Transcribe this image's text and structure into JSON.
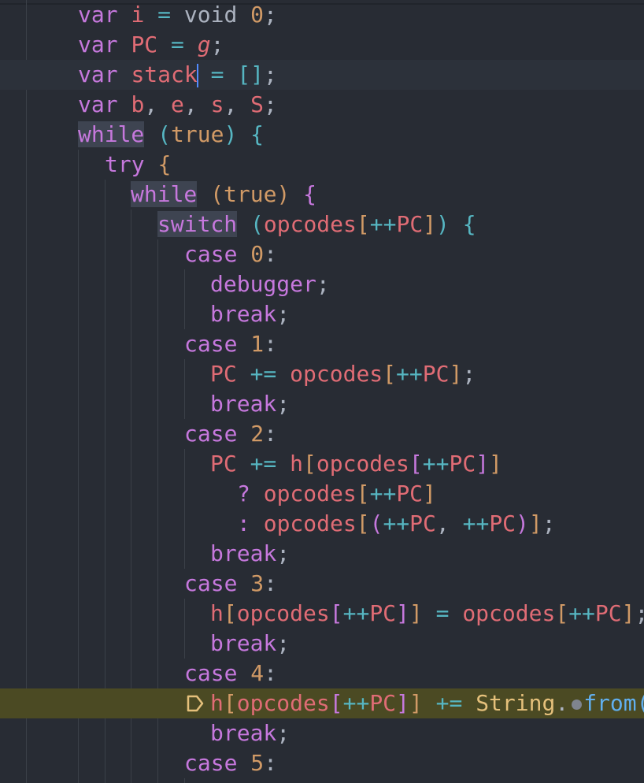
{
  "editor": {
    "lines": [
      [
        "var",
        " ",
        "i",
        " ",
        "=",
        " ",
        "void",
        " ",
        "0",
        ";"
      ],
      [
        "var",
        " ",
        "PC",
        " ",
        "=",
        " ",
        "g",
        ";"
      ],
      [
        "var",
        " ",
        "stack",
        " ",
        "=",
        " ",
        "[",
        "]",
        ";"
      ],
      [
        "var",
        " ",
        "b",
        ", ",
        "e",
        ", ",
        "s",
        ", ",
        "S",
        ";"
      ],
      [
        "while",
        " ",
        "(",
        "true",
        ")",
        " ",
        "{"
      ],
      [
        "try",
        " ",
        "{"
      ],
      [
        "while",
        " ",
        "(",
        "true",
        ")",
        " ",
        "{"
      ],
      [
        "switch",
        " ",
        "(",
        "opcodes",
        "[",
        "++",
        "PC",
        "]",
        ")",
        " ",
        "{"
      ],
      [
        "case",
        " ",
        "0",
        ":"
      ],
      [
        "debugger",
        ";"
      ],
      [
        "break",
        ";"
      ],
      [
        "case",
        " ",
        "1",
        ":"
      ],
      [
        "PC",
        " ",
        "+=",
        " ",
        "opcodes",
        "[",
        "++",
        "PC",
        "]",
        ";"
      ],
      [
        "break",
        ";"
      ],
      [
        "case",
        " ",
        "2",
        ":"
      ],
      [
        "PC",
        " ",
        "+=",
        " ",
        "h",
        "[",
        "opcodes",
        "[",
        "++",
        "PC",
        "]",
        "]"
      ],
      [
        "?",
        " ",
        "opcodes",
        "[",
        "++",
        "PC",
        "]"
      ],
      [
        ":",
        " ",
        "opcodes",
        "[",
        "(",
        "++",
        "PC",
        ", ",
        "++",
        "PC",
        ")",
        "]",
        ";"
      ],
      [
        "break",
        ";"
      ],
      [
        "case",
        " ",
        "3",
        ":"
      ],
      [
        "h",
        "[",
        "opcodes",
        "[",
        "++",
        "PC",
        "]",
        "]",
        " ",
        "=",
        " ",
        "opcodes",
        "[",
        "++",
        "PC",
        "]",
        ";"
      ],
      [
        "break",
        ";"
      ],
      [
        "case",
        " ",
        "4",
        ":"
      ],
      [
        "h",
        "[",
        "opcodes",
        "[",
        "++",
        "PC",
        "]",
        "]",
        " ",
        "+=",
        " ",
        "String",
        ".",
        "from("
      ],
      [
        "break",
        ";"
      ],
      [
        "case",
        " ",
        "5",
        ":"
      ]
    ]
  },
  "colors": {
    "background": "#282c34",
    "keyword": "#c678dd",
    "variable": "#e06c75",
    "number": "#d19a66",
    "operator": "#56b6c2",
    "function": "#61afef",
    "class": "#e5c07b",
    "execution_highlight": "#4b4a23"
  },
  "icons": {
    "breakpoint": "execution-pointer-icon",
    "inline_hint": "inline-dot-icon"
  }
}
